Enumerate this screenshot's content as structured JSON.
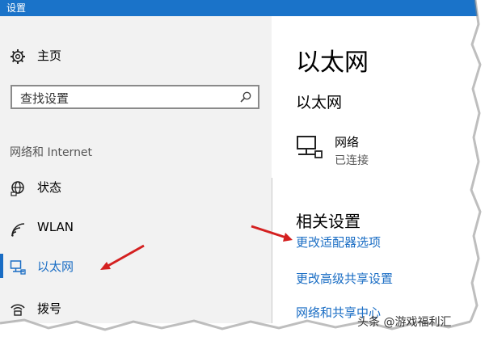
{
  "window": {
    "title": "设置"
  },
  "sidebar": {
    "home_label": "主页",
    "search_placeholder": "查找设置",
    "section_title": "网络和 Internet",
    "items": [
      {
        "label": "状态",
        "icon": "globe-icon"
      },
      {
        "label": "WLAN",
        "icon": "wifi-icon"
      },
      {
        "label": "以太网",
        "icon": "ethernet-icon",
        "active": true
      },
      {
        "label": "拨号",
        "icon": "dialup-icon"
      }
    ]
  },
  "main": {
    "page_title": "以太网",
    "sub_title": "以太网",
    "network": {
      "name": "网络",
      "status": "已连接"
    },
    "related_title": "相关设置",
    "links": [
      "更改适配器选项",
      "更改高级共享设置",
      "网络和共享中心"
    ]
  },
  "watermark": "头条 @游戏福利汇",
  "colors": {
    "accent": "#1a6dc4",
    "titlebar": "#1a73c9",
    "arrow": "#d42020",
    "sidebar_bg": "#f2f2f2"
  }
}
